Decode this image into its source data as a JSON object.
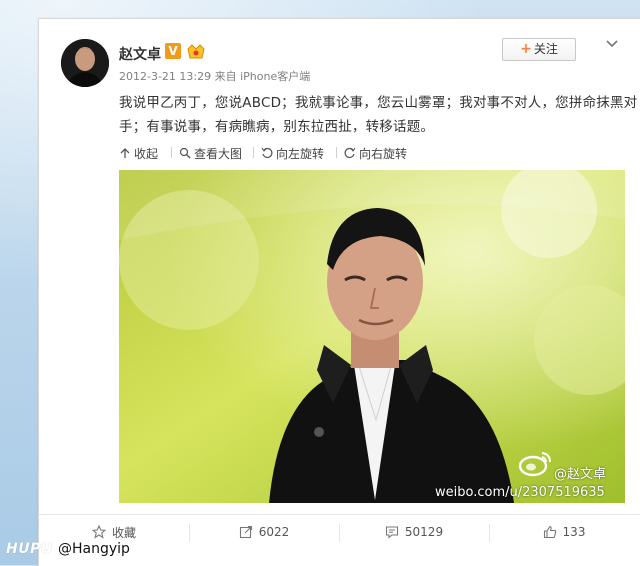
{
  "post": {
    "username": "赵文卓",
    "verified_badge": "V",
    "timestamp_source": "2012-3-21 13:29 来自 iPhone客户端",
    "follow_label": "关注",
    "content": "我说甲乙丙丁，您说ABCD；我就事论事，您云山雾罩；我对事不对人，您拼命抹黑对手；有事说事，有病瞧病，别东拉西扯，转移话题。"
  },
  "tools": {
    "collapse": "收起",
    "view_large": "查看大图",
    "rotate_left": "向左旋转",
    "rotate_right": "向右旋转"
  },
  "image": {
    "watermark_url": "weibo.com/u/2307519635",
    "watermark_user": "@赵文卓"
  },
  "actions": {
    "favorite": "收藏",
    "repost_count": "6022",
    "comment_count": "50129",
    "like_count": "133"
  },
  "overlay": {
    "brand": "HUPU",
    "handle": "@Hangyip"
  },
  "colors": {
    "accent": "#ff8140",
    "badge": "#f19b1a",
    "text": "#333333",
    "meta": "#808080"
  },
  "icons": [
    "v-verified-icon",
    "vip-icon",
    "chevron-down-icon",
    "collapse-icon",
    "zoom-icon",
    "rotate-left-icon",
    "rotate-right-icon",
    "star-icon",
    "repost-icon",
    "comment-icon",
    "thumbs-up-icon",
    "weibo-logo-icon"
  ]
}
